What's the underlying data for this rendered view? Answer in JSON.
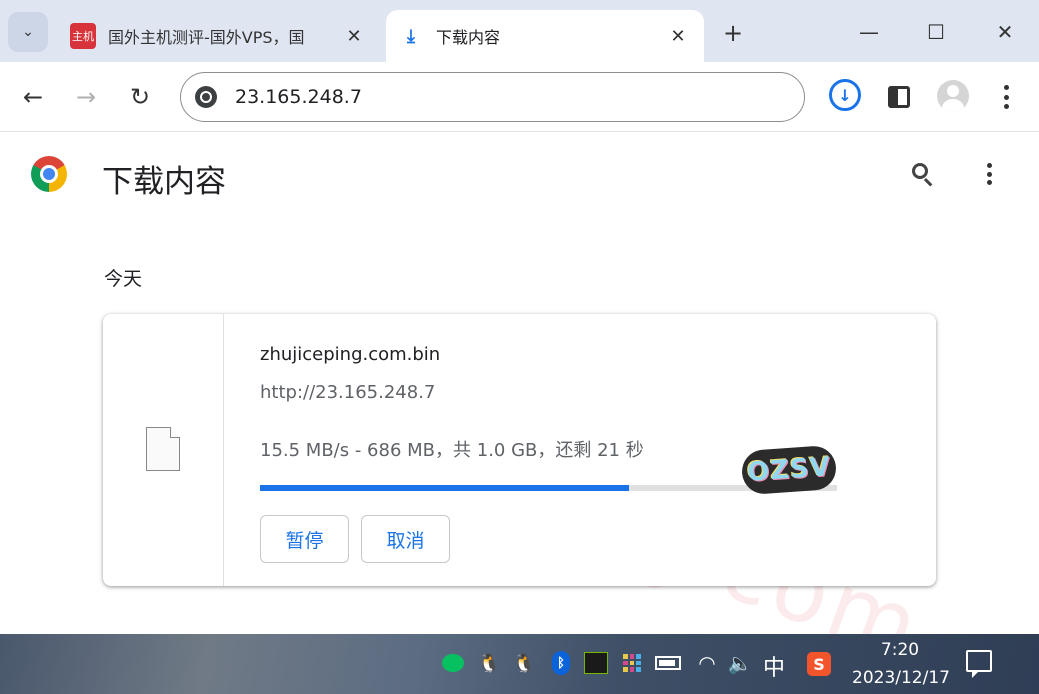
{
  "tabs": [
    {
      "title": "国外主机测评-国外VPS，国",
      "favicon_text": "主机",
      "close": "✕"
    },
    {
      "title": "下载内容",
      "icon": "download-icon",
      "close": "✕"
    }
  ],
  "tabstrip": {
    "search_icon": "⌄",
    "new_tab": "+"
  },
  "window": {
    "minimize": "—",
    "maximize": "☐",
    "close": "✕"
  },
  "toolbar": {
    "back": "←",
    "forward": "→",
    "reload": "↻",
    "address": "23.165.248.7",
    "download_indicator": "↓"
  },
  "page": {
    "title": "下载内容",
    "date_group": "今天",
    "watermark": "zhujiceping.com"
  },
  "download": {
    "file_name": "zhujiceping.com.bin",
    "url": "http://23.165.248.7",
    "status": "15.5 MB/s - 686 MB，共 1.0 GB，还剩 21 秒",
    "progress": 0.64,
    "pause_label": "暂停",
    "cancel_label": "取消",
    "sticker_text": "OZSV"
  },
  "taskbar": {
    "tray": [
      "wechat-icon",
      "qq-icon",
      "qq-icon",
      "bluetooth-icon",
      "nvidia-icon",
      "grid-app-icon",
      "battery-icon",
      "wifi-icon",
      "volume-icon"
    ],
    "ime": "中",
    "sogou": "S",
    "time": "7:20",
    "date": "2023/12/17"
  },
  "colors": {
    "accent": "#1a73e8",
    "tabstrip": "#dfe6f2",
    "progress_track": "#e0e0e0"
  }
}
